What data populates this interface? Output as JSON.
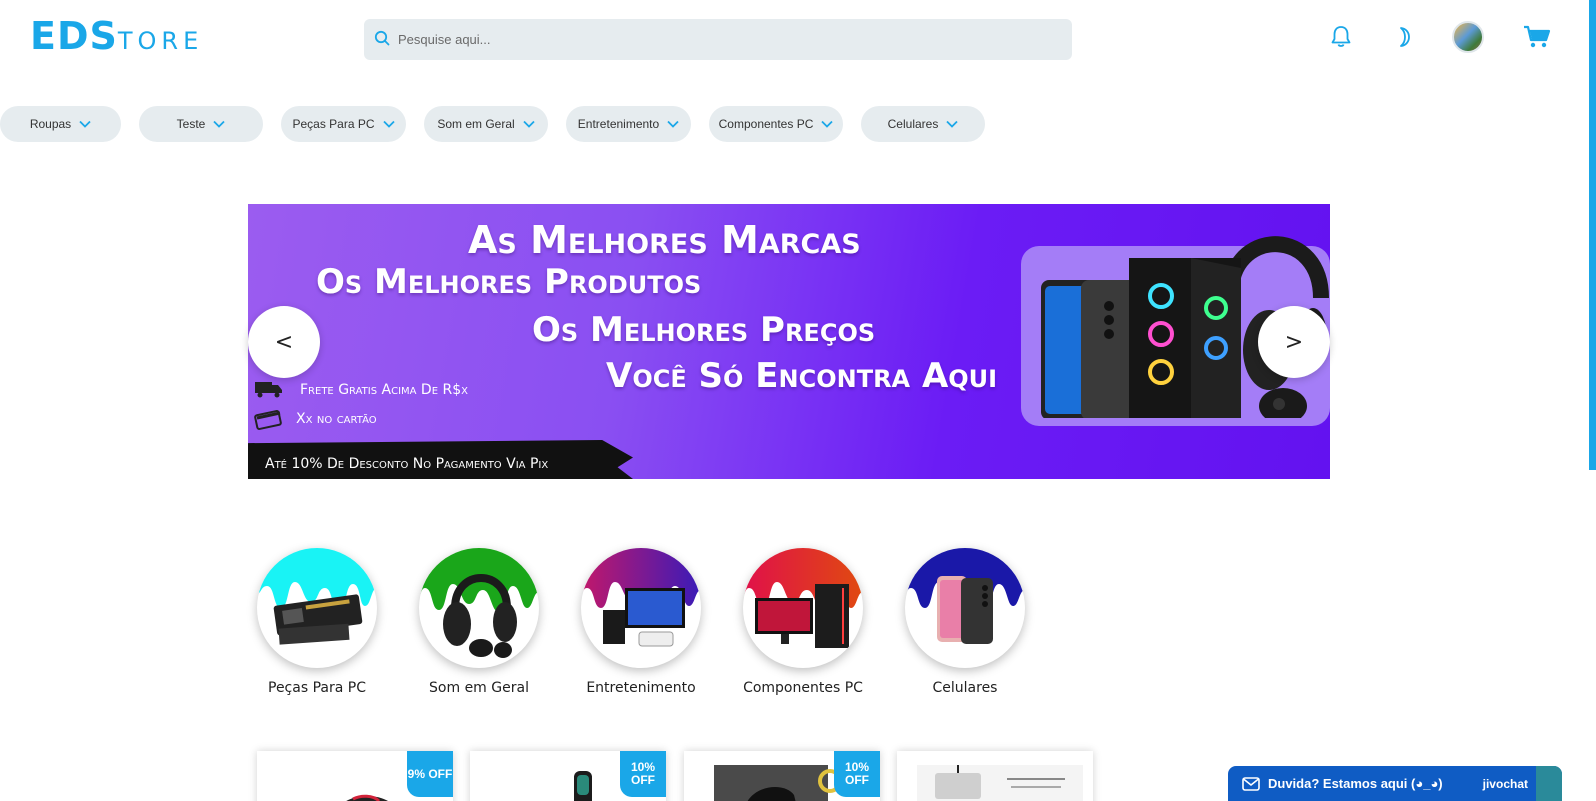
{
  "header": {
    "logo_big": "EDS",
    "logo_small": "TORE",
    "search_placeholder": "Pesquise aqui..."
  },
  "categories_nav": [
    {
      "label": "Roupas"
    },
    {
      "label": "Teste"
    },
    {
      "label": "Peças Para PC"
    },
    {
      "label": "Som em Geral"
    },
    {
      "label": "Entretenimento"
    },
    {
      "label": "Componentes PC"
    },
    {
      "label": "Celulares"
    }
  ],
  "banner": {
    "line1": "As Melhores Marcas",
    "line2": "Os Melhores Produtos",
    "line3": "Os Melhores Preços",
    "line4": "Você Só Encontra Aqui",
    "shipping": "Frete Gratis Acima De R$x",
    "installments": "Xx no cartão",
    "pix": "Até 10% De Desconto No Pagamento Via Pix",
    "prev": "<",
    "next": ">"
  },
  "featured_categories": [
    {
      "label": "Peças Para PC",
      "color": "#19f3f5"
    },
    {
      "label": "Som em Geral",
      "color": "#1aa61a"
    },
    {
      "label": "Entretenimento",
      "color": "#9b1bb0"
    },
    {
      "label": "Componentes PC",
      "color": "#e01818"
    },
    {
      "label": "Celulares",
      "color": "#1a18a8"
    }
  ],
  "products": [
    {
      "badge": "9% OFF"
    },
    {
      "badge": "10% OFF"
    },
    {
      "badge": "10% OFF"
    },
    {
      "badge": ""
    }
  ],
  "chat": {
    "label": "Duvida? Estamos aqui (◕_◕)",
    "brand": "jivochat"
  },
  "colors": {
    "accent": "#1aa7e8",
    "pill_bg": "#e6ecef",
    "chat_bg": "#0f5cc4"
  }
}
